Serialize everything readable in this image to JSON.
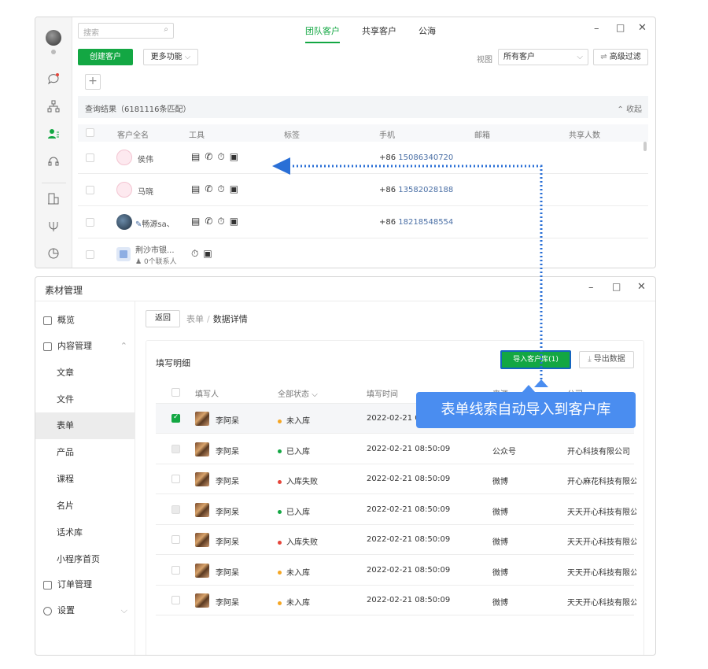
{
  "crm": {
    "search_placeholder": "搜索",
    "tabs": [
      "团队客户",
      "共享客户",
      "公海"
    ],
    "create_btn": "创建客户",
    "more_btn": "更多功能",
    "view_label": "视图",
    "view_value": "所有客户",
    "filter_btn": "高级过滤",
    "result_text": "查询结果（6181116条匹配）",
    "collapse": "收起",
    "headers": [
      "客户全名",
      "工具",
      "标签",
      "手机",
      "邮箱",
      "共享人数"
    ],
    "rows": [
      {
        "name": "侯伟",
        "cc": "+86",
        "phone": "15086340720"
      },
      {
        "name": "马晓",
        "cc": "+86",
        "phone": "13582028188"
      },
      {
        "name": "畅源sa、",
        "cc": "+86",
        "phone": "18218548554"
      },
      {
        "name": "荆沙市银...",
        "sub": "0个联系人",
        "cc": "",
        "phone": ""
      }
    ]
  },
  "material": {
    "title": "素材管理",
    "nav": [
      "概览",
      "内容管理",
      "文章",
      "文件",
      "表单",
      "产品",
      "课程",
      "名片",
      "话术库",
      "小程序首页",
      "订单管理",
      "设置"
    ],
    "back": "返回",
    "crumb_parent": "表单",
    "crumb_sep": "/",
    "crumb_current": "数据详情",
    "panel_title": "填写明细",
    "import_btn": "导入客户库(1)",
    "export_btn": "导出数据",
    "headers": [
      "填写人",
      "全部状态",
      "填写时间",
      "来源",
      "公司"
    ],
    "rows": [
      {
        "name": "李阿呆",
        "status": "未入库",
        "time": "2022-02-21 0",
        "source": "",
        "company": ""
      },
      {
        "name": "李阿呆",
        "status": "已入库",
        "time": "2022-02-21 08:50:09",
        "source": "公众号",
        "company": "开心科技有限公司"
      },
      {
        "name": "李阿呆",
        "status": "入库失败",
        "time": "2022-02-21 08:50:09",
        "source": "微博",
        "company": "开心麻花科技有限公"
      },
      {
        "name": "李阿呆",
        "status": "已入库",
        "time": "2022-02-21 08:50:09",
        "source": "微博",
        "company": "天天开心科技有限公"
      },
      {
        "name": "李阿呆",
        "status": "入库失败",
        "time": "2022-02-21 08:50:09",
        "source": "微博",
        "company": "天天开心科技有限公"
      },
      {
        "name": "李阿呆",
        "status": "未入库",
        "time": "2022-02-21 08:50:09",
        "source": "微博",
        "company": "天天开心科技有限公"
      },
      {
        "name": "李阿呆",
        "status": "未入库",
        "time": "2022-02-21 08:50:09",
        "source": "微博",
        "company": "天天开心科技有限公"
      }
    ]
  },
  "callout": "表单线索自动导入到客户库",
  "colors": {
    "green": "#13a743",
    "blue": "#4a8df0",
    "pending": "#f5a623",
    "done": "#13a743",
    "fail": "#e5453a"
  }
}
